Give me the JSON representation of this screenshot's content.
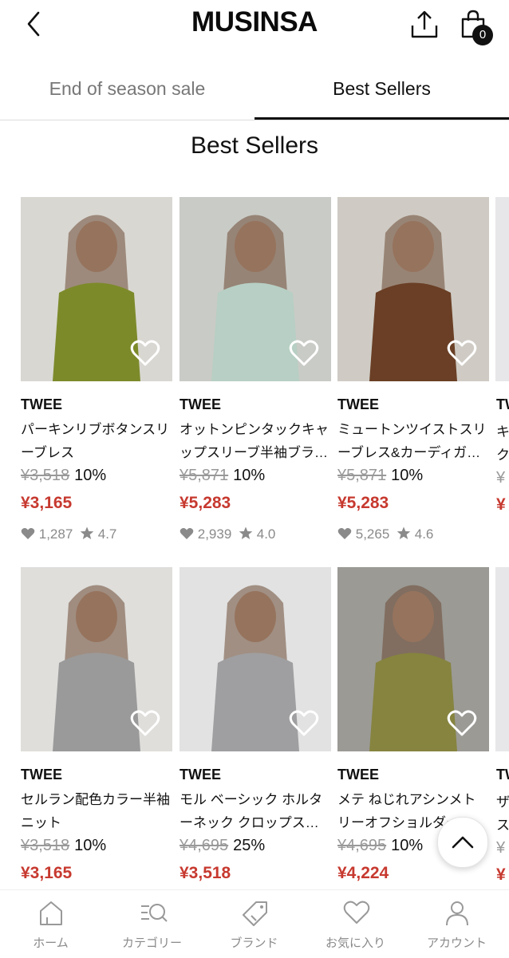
{
  "header": {
    "logo": "MUSINSA",
    "cart_count": "0"
  },
  "tabs": [
    {
      "label": "End of season sale",
      "active": false
    },
    {
      "label": "Best Sellers",
      "active": true
    }
  ],
  "section_title": "Best Sellers",
  "products": [
    {
      "brand": "TWEE",
      "name": "パーキンリブボタンスリーブレス",
      "orig_price": "¥3,518",
      "discount": "10%",
      "sale_price": "¥3,165",
      "likes": "1,287",
      "rating": "4.7",
      "photo_bg": "#d9d7d2",
      "garment": "#7d8a2a"
    },
    {
      "brand": "TWEE",
      "name": "オットンピンタックキャップスリーブ半袖ブラ…",
      "orig_price": "¥5,871",
      "discount": "10%",
      "sale_price": "¥5,283",
      "likes": "2,939",
      "rating": "4.0",
      "photo_bg": "#c9cbc6",
      "garment": "#b7cfc4"
    },
    {
      "brand": "TWEE",
      "name": "ミュートンツイストスリーブレス&カーディガ…",
      "orig_price": "¥5,871",
      "discount": "10%",
      "sale_price": "¥5,283",
      "likes": "5,265",
      "rating": "4.6",
      "photo_bg": "#cfcbc4",
      "garment": "#6a3f25"
    },
    {
      "brand": "TWEE",
      "name": "セルラン配色カラー半袖ニット",
      "orig_price": "¥3,518",
      "discount": "10%",
      "sale_price": "¥3,165",
      "photo_bg": "#dfdedb",
      "garment": "#9a9a9a"
    },
    {
      "brand": "TWEE",
      "name": "モル ベーシック ホルターネック クロップス…",
      "orig_price": "¥4,695",
      "discount": "25%",
      "sale_price": "¥3,518",
      "photo_bg": "#e2e2e2",
      "garment": "#9f9fa1"
    },
    {
      "brand": "TWEE",
      "name": "メテ ねじれアシンメトリーオフショルダー…",
      "orig_price": "¥4,695",
      "discount": "10%",
      "sale_price": "¥4,224",
      "photo_bg": "#9b9a95",
      "garment": "#86843f"
    }
  ],
  "peek": {
    "row1": {
      "brand": "TW",
      "line1": "キ",
      "line2": "ク",
      "orig": "¥",
      "sale": "¥"
    },
    "row2": {
      "brand": "TW",
      "line1": "ザ",
      "line2": "ス",
      "orig": "¥",
      "sale": "¥"
    }
  },
  "nav": [
    {
      "label": "ホーム",
      "icon": "home-icon"
    },
    {
      "label": "カテゴリー",
      "icon": "category-search-icon"
    },
    {
      "label": "ブランド",
      "icon": "brand-tag-icon"
    },
    {
      "label": "お気に入り",
      "icon": "heart-icon"
    },
    {
      "label": "アカウント",
      "icon": "account-icon"
    }
  ],
  "colors": {
    "accent_red": "#c7392f",
    "text": "#111111",
    "muted": "#8a8a8a"
  }
}
